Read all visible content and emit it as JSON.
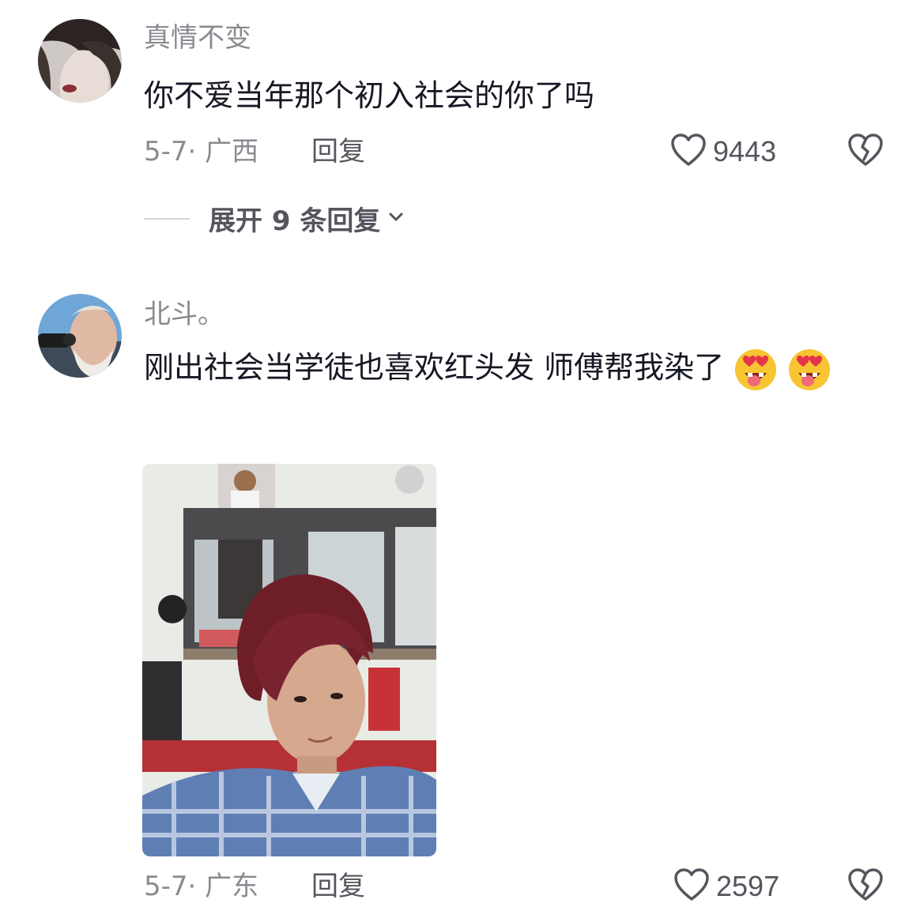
{
  "comments": [
    {
      "username": "真情不变",
      "text": "你不爱当年那个初入社会的你了吗",
      "meta": "5-7· 广西",
      "reply_label": "回复",
      "likes": "9443",
      "expand_label": "展开 9 条回复"
    },
    {
      "username": "北斗。",
      "text": "刚出社会当学徒也喜欢红头发 师傅帮我染了",
      "emoji": "heart-eyes-tongue-emoji",
      "meta": "5-7· 广东",
      "reply_label": "回复",
      "likes": "2597"
    }
  ],
  "colors": {
    "primary_text": "#161823",
    "secondary_text": "#8a8b91",
    "action_text": "#54555d",
    "divider": "#d4d5d9"
  },
  "icons": {
    "like": "heart-outline-icon",
    "dislike": "broken-heart-icon",
    "expand": "chevron-down-icon"
  }
}
